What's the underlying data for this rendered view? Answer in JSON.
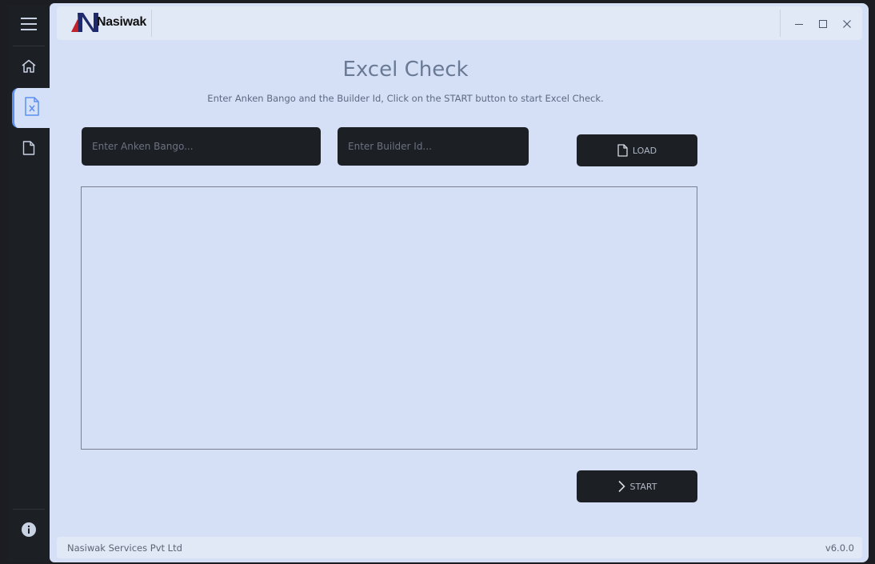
{
  "app": {
    "brand_name": "Nasiwak",
    "brand_colors": {
      "mark_dark": "#1e2a6b",
      "mark_red": "#c0232c"
    }
  },
  "sidebar": {
    "items": [
      {
        "name": "menu",
        "icon": "hamburger-icon"
      },
      {
        "name": "home",
        "icon": "home-icon"
      },
      {
        "name": "excel-check",
        "icon": "excel-file-icon",
        "active": true
      },
      {
        "name": "document",
        "icon": "document-icon"
      },
      {
        "name": "info",
        "icon": "info-icon"
      }
    ]
  },
  "window_controls": [
    "minimize-icon",
    "maximize-icon",
    "close-icon"
  ],
  "main": {
    "title": "Excel Check",
    "subtitle": "Enter Anken Bango and the Builder Id, Click on the START button to start Excel Check.",
    "anken_input": {
      "value": "",
      "placeholder": "Enter Anken Bango..."
    },
    "builder_input": {
      "value": "",
      "placeholder": "Enter Builder Id..."
    },
    "load_label": "LOAD",
    "start_label": "START",
    "output_text": ""
  },
  "footer": {
    "company": "Nasiwak Services Pvt Ltd",
    "version": "v6.0.0"
  },
  "colors": {
    "accent": "#5b8ff0",
    "dark_panel": "#1c1f24",
    "window_bg": "#d5e0f6"
  }
}
